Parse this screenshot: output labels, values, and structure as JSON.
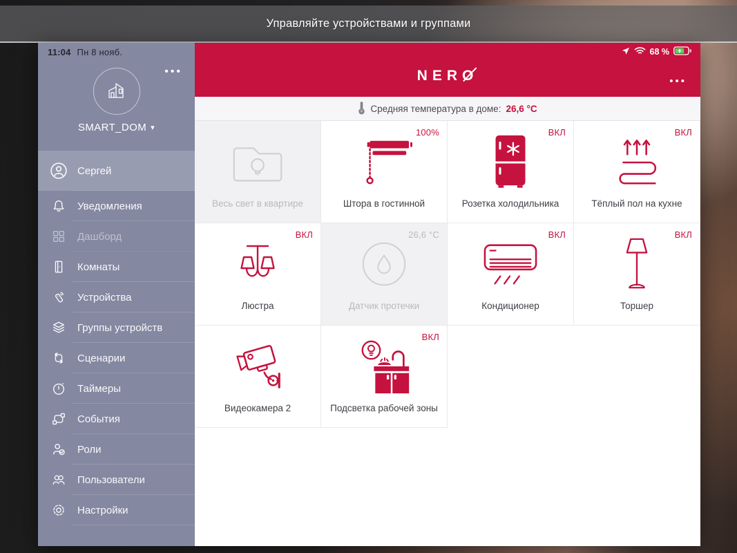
{
  "banner": {
    "title": "Управляйте устройствами и группами"
  },
  "status_bar": {
    "time": "11:04",
    "date": "Пн 8 нояб.",
    "battery_percent": "68 %"
  },
  "sidebar": {
    "home_name": "SMART_DOM",
    "items": [
      {
        "label": "Сергей",
        "selected": true
      },
      {
        "label": "Уведомления"
      },
      {
        "label": "Дашборд",
        "active_dimmed": true
      },
      {
        "label": "Комнаты"
      },
      {
        "label": "Устройства"
      },
      {
        "label": "Группы устройств"
      },
      {
        "label": "Сценарии"
      },
      {
        "label": "Таймеры"
      },
      {
        "label": "События"
      },
      {
        "label": "Роли"
      },
      {
        "label": "Пользователи"
      },
      {
        "label": "Настройки"
      }
    ]
  },
  "header": {
    "logo_prefix": "NER",
    "logo_o": "O"
  },
  "temperature": {
    "label": "Средняя температура в доме:",
    "value": "26,6 °C"
  },
  "tiles": [
    {
      "name": "Весь свет в квартире",
      "status": "",
      "state": "disabled",
      "icon": "lights-group-icon"
    },
    {
      "name": "Штора в гостинной",
      "status": "100%",
      "state": "normal",
      "icon": "blind-icon"
    },
    {
      "name": "Розетка холодильника",
      "status": "ВКЛ",
      "state": "on",
      "icon": "fridge-icon"
    },
    {
      "name": "Тёплый пол на кухне",
      "status": "ВКЛ",
      "state": "on",
      "icon": "heated-floor-icon"
    },
    {
      "name": "Люстра",
      "status": "ВКЛ",
      "state": "on",
      "icon": "chandelier-icon"
    },
    {
      "name": "Датчик протечки",
      "status": "26,6 °C",
      "state": "disabled",
      "icon": "leak-sensor-icon"
    },
    {
      "name": "Кондиционер",
      "status": "ВКЛ",
      "state": "on",
      "icon": "air-conditioner-icon"
    },
    {
      "name": "Торшер",
      "status": "ВКЛ",
      "state": "on",
      "icon": "floor-lamp-icon"
    },
    {
      "name": "Видеокамера 2",
      "status": "",
      "state": "normal",
      "icon": "cctv-camera-icon"
    },
    {
      "name": "Подсветка рабочей зоны",
      "status": "ВКЛ",
      "state": "on",
      "icon": "worktop-light-icon"
    }
  ],
  "icons": {
    "chevron_down": "▾",
    "more_dots": "•••"
  },
  "colors": {
    "accent": "#C5123E",
    "sidebar": "#8488A1",
    "sidebar_selected": "#989CB0",
    "battery_green": "#57D15E"
  }
}
